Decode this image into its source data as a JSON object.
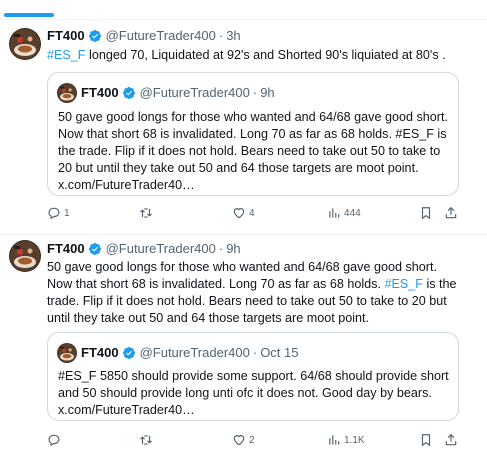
{
  "tweet1": {
    "name": "FT400",
    "handle": "@FutureTrader400",
    "dot": "·",
    "time": "3h",
    "text_tag": "#ES_F",
    "text_rest": " longed 70, Liquidated at 92's and Shorted 90's liquiated at 80's .",
    "quote": {
      "name": "FT400",
      "handle": "@FutureTrader400",
      "dot": "·",
      "time": "9h",
      "line1": "50 gave good longs for those who wanted and 64/68 gave good short.",
      "line2": "Now that short 68 is invalidated. Long 70 as far as 68 holds. #ES_F is",
      "line3": "the trade. Flip if it does not hold. Bears need to take out 50 to take to",
      "line4": "20 but until they take out 50 and 64 those targets are moot point.",
      "line5": "x.com/FutureTrader40…"
    },
    "replies": "1",
    "retweets": "",
    "likes": "4",
    "views": "444"
  },
  "tweet2": {
    "name": "FT400",
    "handle": "@FutureTrader400",
    "dot": "·",
    "time": "9h",
    "line1": "50 gave good longs for those who wanted and 64/68 gave good short.",
    "line2_pre": "Now that short 68 is invalidated. Long 70 as far as 68 holds. ",
    "line2_tag": "#ES_F",
    "line2_post": " is the",
    "line3": "trade. Flip if it does not hold. Bears need to take out 50 to take to 20 but",
    "line4": "until they take out 50 and 64 those targets are moot point.",
    "quote": {
      "name": "FT400",
      "handle": "@FutureTrader400",
      "dot": "·",
      "time": "Oct 15",
      "line1": "#ES_F 5850 should provide some support. 64/68 should provide short",
      "line2": "and 50 should provide long unti ofc it does not.  Good day by bears.",
      "line3": "x.com/FutureTrader40…"
    },
    "replies": "",
    "retweets": "",
    "likes": "2",
    "views": "1.1K"
  },
  "colors": {
    "accent": "#1d9bf0",
    "muted": "#536471",
    "text": "#0f1419",
    "border": "#cfd9de"
  },
  "icons": [
    "verified-badge-icon",
    "reply-icon",
    "retweet-icon",
    "like-icon",
    "views-icon",
    "bookmark-icon",
    "share-icon"
  ]
}
